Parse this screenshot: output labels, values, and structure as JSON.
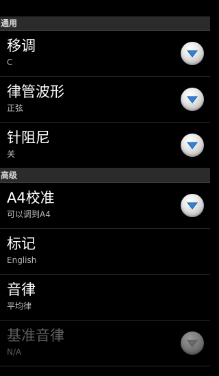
{
  "colors": {
    "background": "#000000",
    "section_header_bg": "#2b2b2b",
    "accent_arrow": "#2f84d6",
    "disabled_arrow": "#6a6a6a"
  },
  "sections": [
    {
      "header": "通用",
      "items": [
        {
          "title": "移调",
          "summary": "C",
          "has_dropdown": true,
          "enabled": true
        },
        {
          "title": "律管波形",
          "summary": "正弦",
          "has_dropdown": true,
          "enabled": true
        },
        {
          "title": "针阻尼",
          "summary": "关",
          "has_dropdown": true,
          "enabled": true
        }
      ]
    },
    {
      "header": "高级",
      "items": [
        {
          "title": "A4校准",
          "summary": "可以调到A4",
          "has_dropdown": true,
          "enabled": true
        },
        {
          "title": "标记",
          "summary": "English",
          "has_dropdown": false,
          "enabled": true
        },
        {
          "title": "音律",
          "summary": "平均律",
          "has_dropdown": false,
          "enabled": true
        },
        {
          "title": "基准音律",
          "summary": "N/A",
          "has_dropdown": true,
          "enabled": false
        }
      ]
    }
  ]
}
